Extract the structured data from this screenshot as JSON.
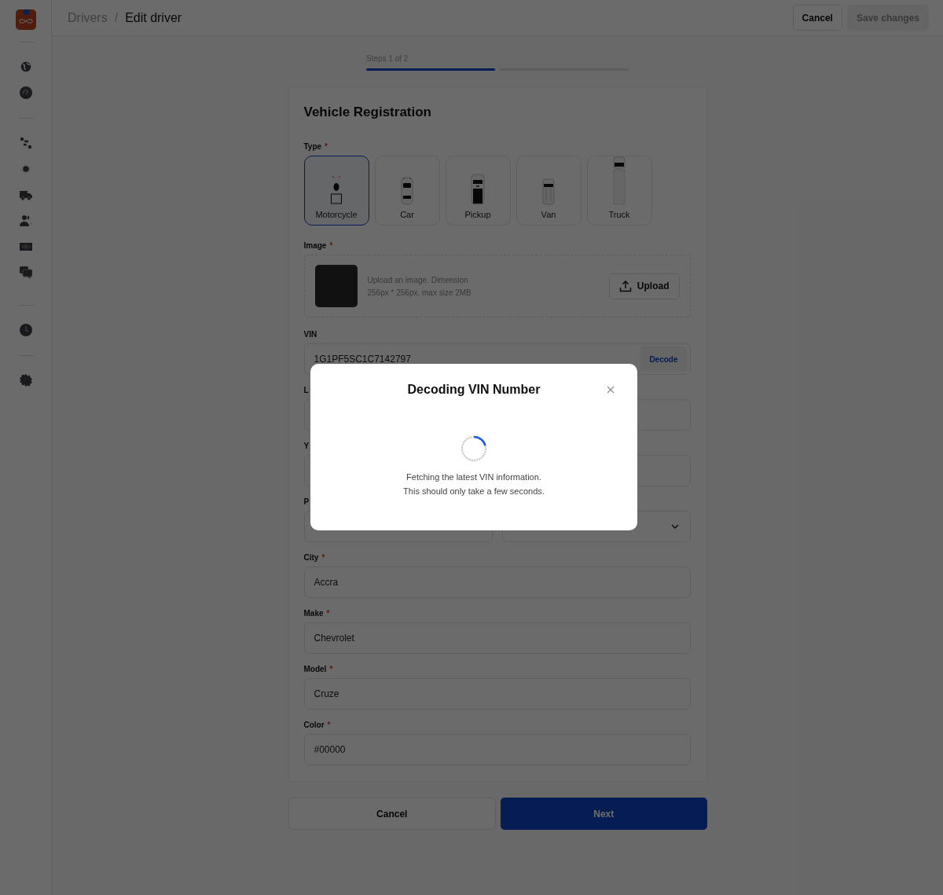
{
  "header": {
    "breadcrumb": [
      {
        "label": "Drivers",
        "current": false
      },
      {
        "label": "Edit driver",
        "current": true
      }
    ],
    "separator": "/",
    "cancel": "Cancel",
    "save": {
      "label": "Save changes",
      "disabled": true
    }
  },
  "stepper": {
    "label": "Steps 1 of 2",
    "steps": [
      {
        "done": true
      },
      {
        "done": false
      }
    ]
  },
  "form": {
    "title": "Vehicle Registration",
    "type": {
      "label": "Type",
      "required_mark": "*",
      "options": [
        {
          "label": "Motorcycle",
          "selected": true
        },
        {
          "label": "Car",
          "selected": false
        },
        {
          "label": "Pickup",
          "selected": false
        },
        {
          "label": "Van",
          "selected": false
        },
        {
          "label": "Truck",
          "selected": false
        }
      ]
    },
    "image": {
      "label": "Image",
      "required_mark": "*",
      "hint": [
        "Upload an image. Dimension",
        "256px * 256px. max size 2MB"
      ],
      "upload": "Upload"
    },
    "vin": {
      "label": "VIN",
      "value": "1G1PF5SC1C7142797",
      "action": "Decode"
    },
    "rows": [
      [
        {
          "label": "L",
          "kind": "text"
        }
      ],
      [
        {
          "label": "Y",
          "kind": "text"
        }
      ],
      [
        {
          "label": "P",
          "kind": "text"
        },
        {
          "kind": "select"
        }
      ]
    ],
    "fields": [
      {
        "label": "City",
        "required_mark": "*",
        "value": "Accra"
      },
      {
        "label": "Make",
        "required_mark": "*",
        "value": "Chevrolet"
      },
      {
        "label": "Model",
        "required_mark": "*",
        "value": "Cruze"
      },
      {
        "label": "Color",
        "required_mark": "*",
        "value": "#00000"
      }
    ]
  },
  "footer": {
    "cancel": "Cancel",
    "next": "Next"
  },
  "modal": {
    "title": "Decoding VIN Number",
    "message": [
      "Fetching the latest VIN information.",
      "This should only take a few seconds."
    ]
  }
}
